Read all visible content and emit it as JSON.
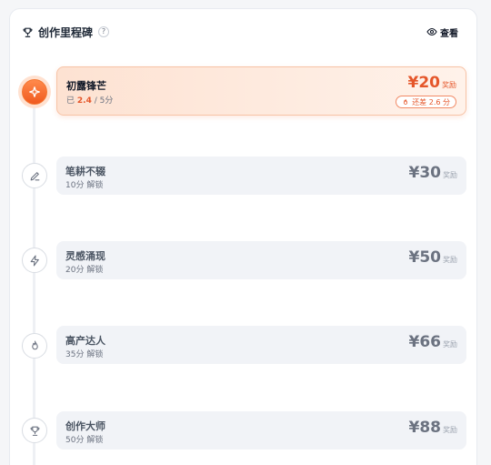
{
  "header": {
    "title": "创作里程碑",
    "help_label": "?",
    "view_label": "查看"
  },
  "colors": {
    "accent": "#e5562a",
    "active_node": "#f05a1f",
    "row_bg": "#f1f3f7"
  },
  "milestones": [
    {
      "name": "初露锋芒",
      "icon": "sparkle-icon",
      "status": "current",
      "progress_prefix": "已",
      "progress_value": "2.4",
      "progress_suffix": "/ 5分",
      "amount": "¥20",
      "amount_unit": "奖励",
      "gap_label": "还差 2.6 分"
    },
    {
      "name": "笔耕不辍",
      "icon": "pen-icon",
      "status": "locked",
      "unlock_text": "10分 解锁",
      "amount": "¥30",
      "amount_unit": "奖励"
    },
    {
      "name": "灵感涌现",
      "icon": "lightning-icon",
      "status": "locked",
      "unlock_text": "20分 解锁",
      "amount": "¥50",
      "amount_unit": "奖励"
    },
    {
      "name": "高产达人",
      "icon": "flame-icon",
      "status": "locked",
      "unlock_text": "35分 解锁",
      "amount": "¥66",
      "amount_unit": "奖励"
    },
    {
      "name": "创作大师",
      "icon": "trophy-icon",
      "status": "locked",
      "unlock_text": "50分 解锁",
      "amount": "¥88",
      "amount_unit": "奖励"
    }
  ]
}
